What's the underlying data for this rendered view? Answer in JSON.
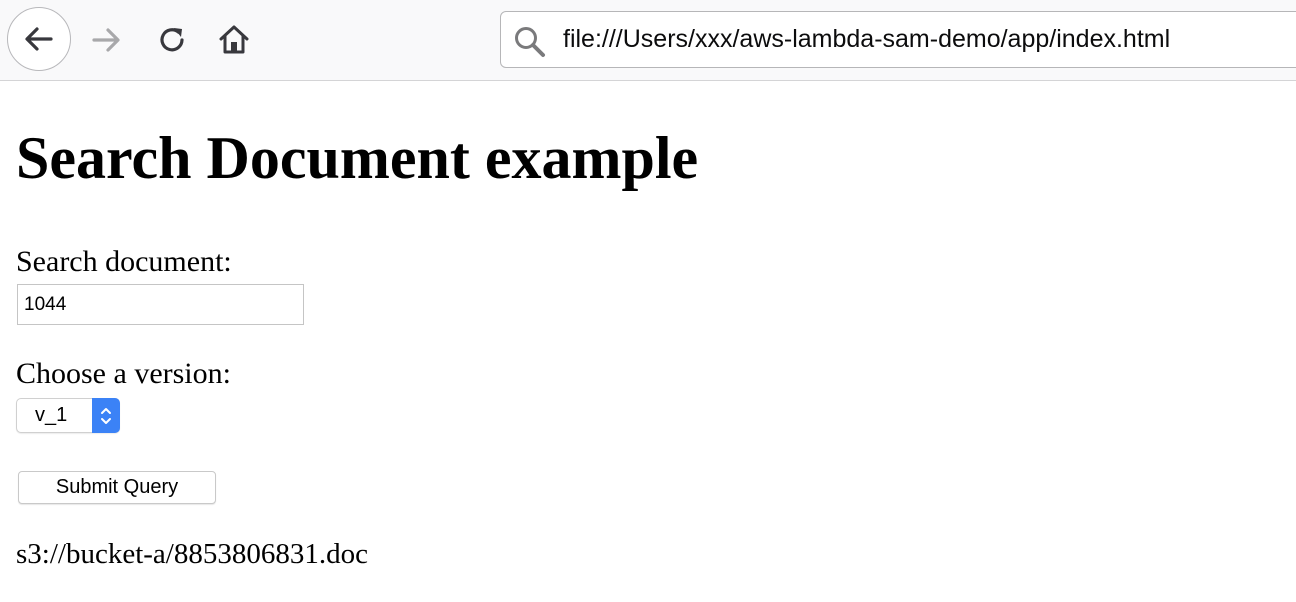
{
  "browser": {
    "url": "file:///Users/xxx/aws-lambda-sam-demo/app/index.html",
    "icons": {
      "back": "arrow-left-icon",
      "forward": "arrow-right-icon",
      "reload": "reload-icon",
      "home": "home-icon",
      "search": "search-icon"
    }
  },
  "page": {
    "title": "Search Document example",
    "search_label": "Search document:",
    "search_value": "1044",
    "version_label": "Choose a version:",
    "version_selected": "v_1",
    "submit_label": "Submit Query",
    "result": "s3://bucket-a/8853806831.doc"
  },
  "colors": {
    "select_accent": "#3b82f6",
    "toolbar_bg": "#f9f9fa"
  }
}
